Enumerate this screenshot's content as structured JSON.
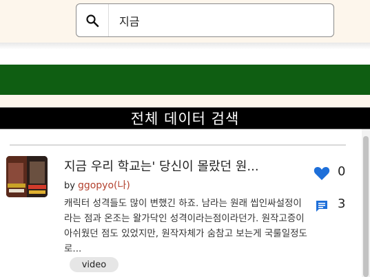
{
  "search": {
    "value": "지금",
    "placeholder": ""
  },
  "header": {
    "title": "전체 데이터 검색"
  },
  "results": [
    {
      "title": "지금 우리 학교는' 당신이 몰랐던 원...",
      "by_label": "by",
      "author": "ggopyo(나)",
      "excerpt": "캐릭터 성격들도 많이 변했긴 하죠. 남라는 원래 씹인싸설정이라는 점과 온조는 왈가닥인 성격이라는점이라던가. 원작고증이 아쉬웠던 점도 있었지만, 원작자체가 숨참고 보는게 국룰일정도로...",
      "likes": "0",
      "comments": "3",
      "tag": "video"
    }
  ],
  "colors": {
    "accent_green": "#0f5e12",
    "heart": "#1e6fd9",
    "author": "#b3412e",
    "header_bg": "#000000"
  },
  "icons": {
    "search": "search-icon",
    "like": "heart-icon",
    "comment": "comment-icon"
  }
}
